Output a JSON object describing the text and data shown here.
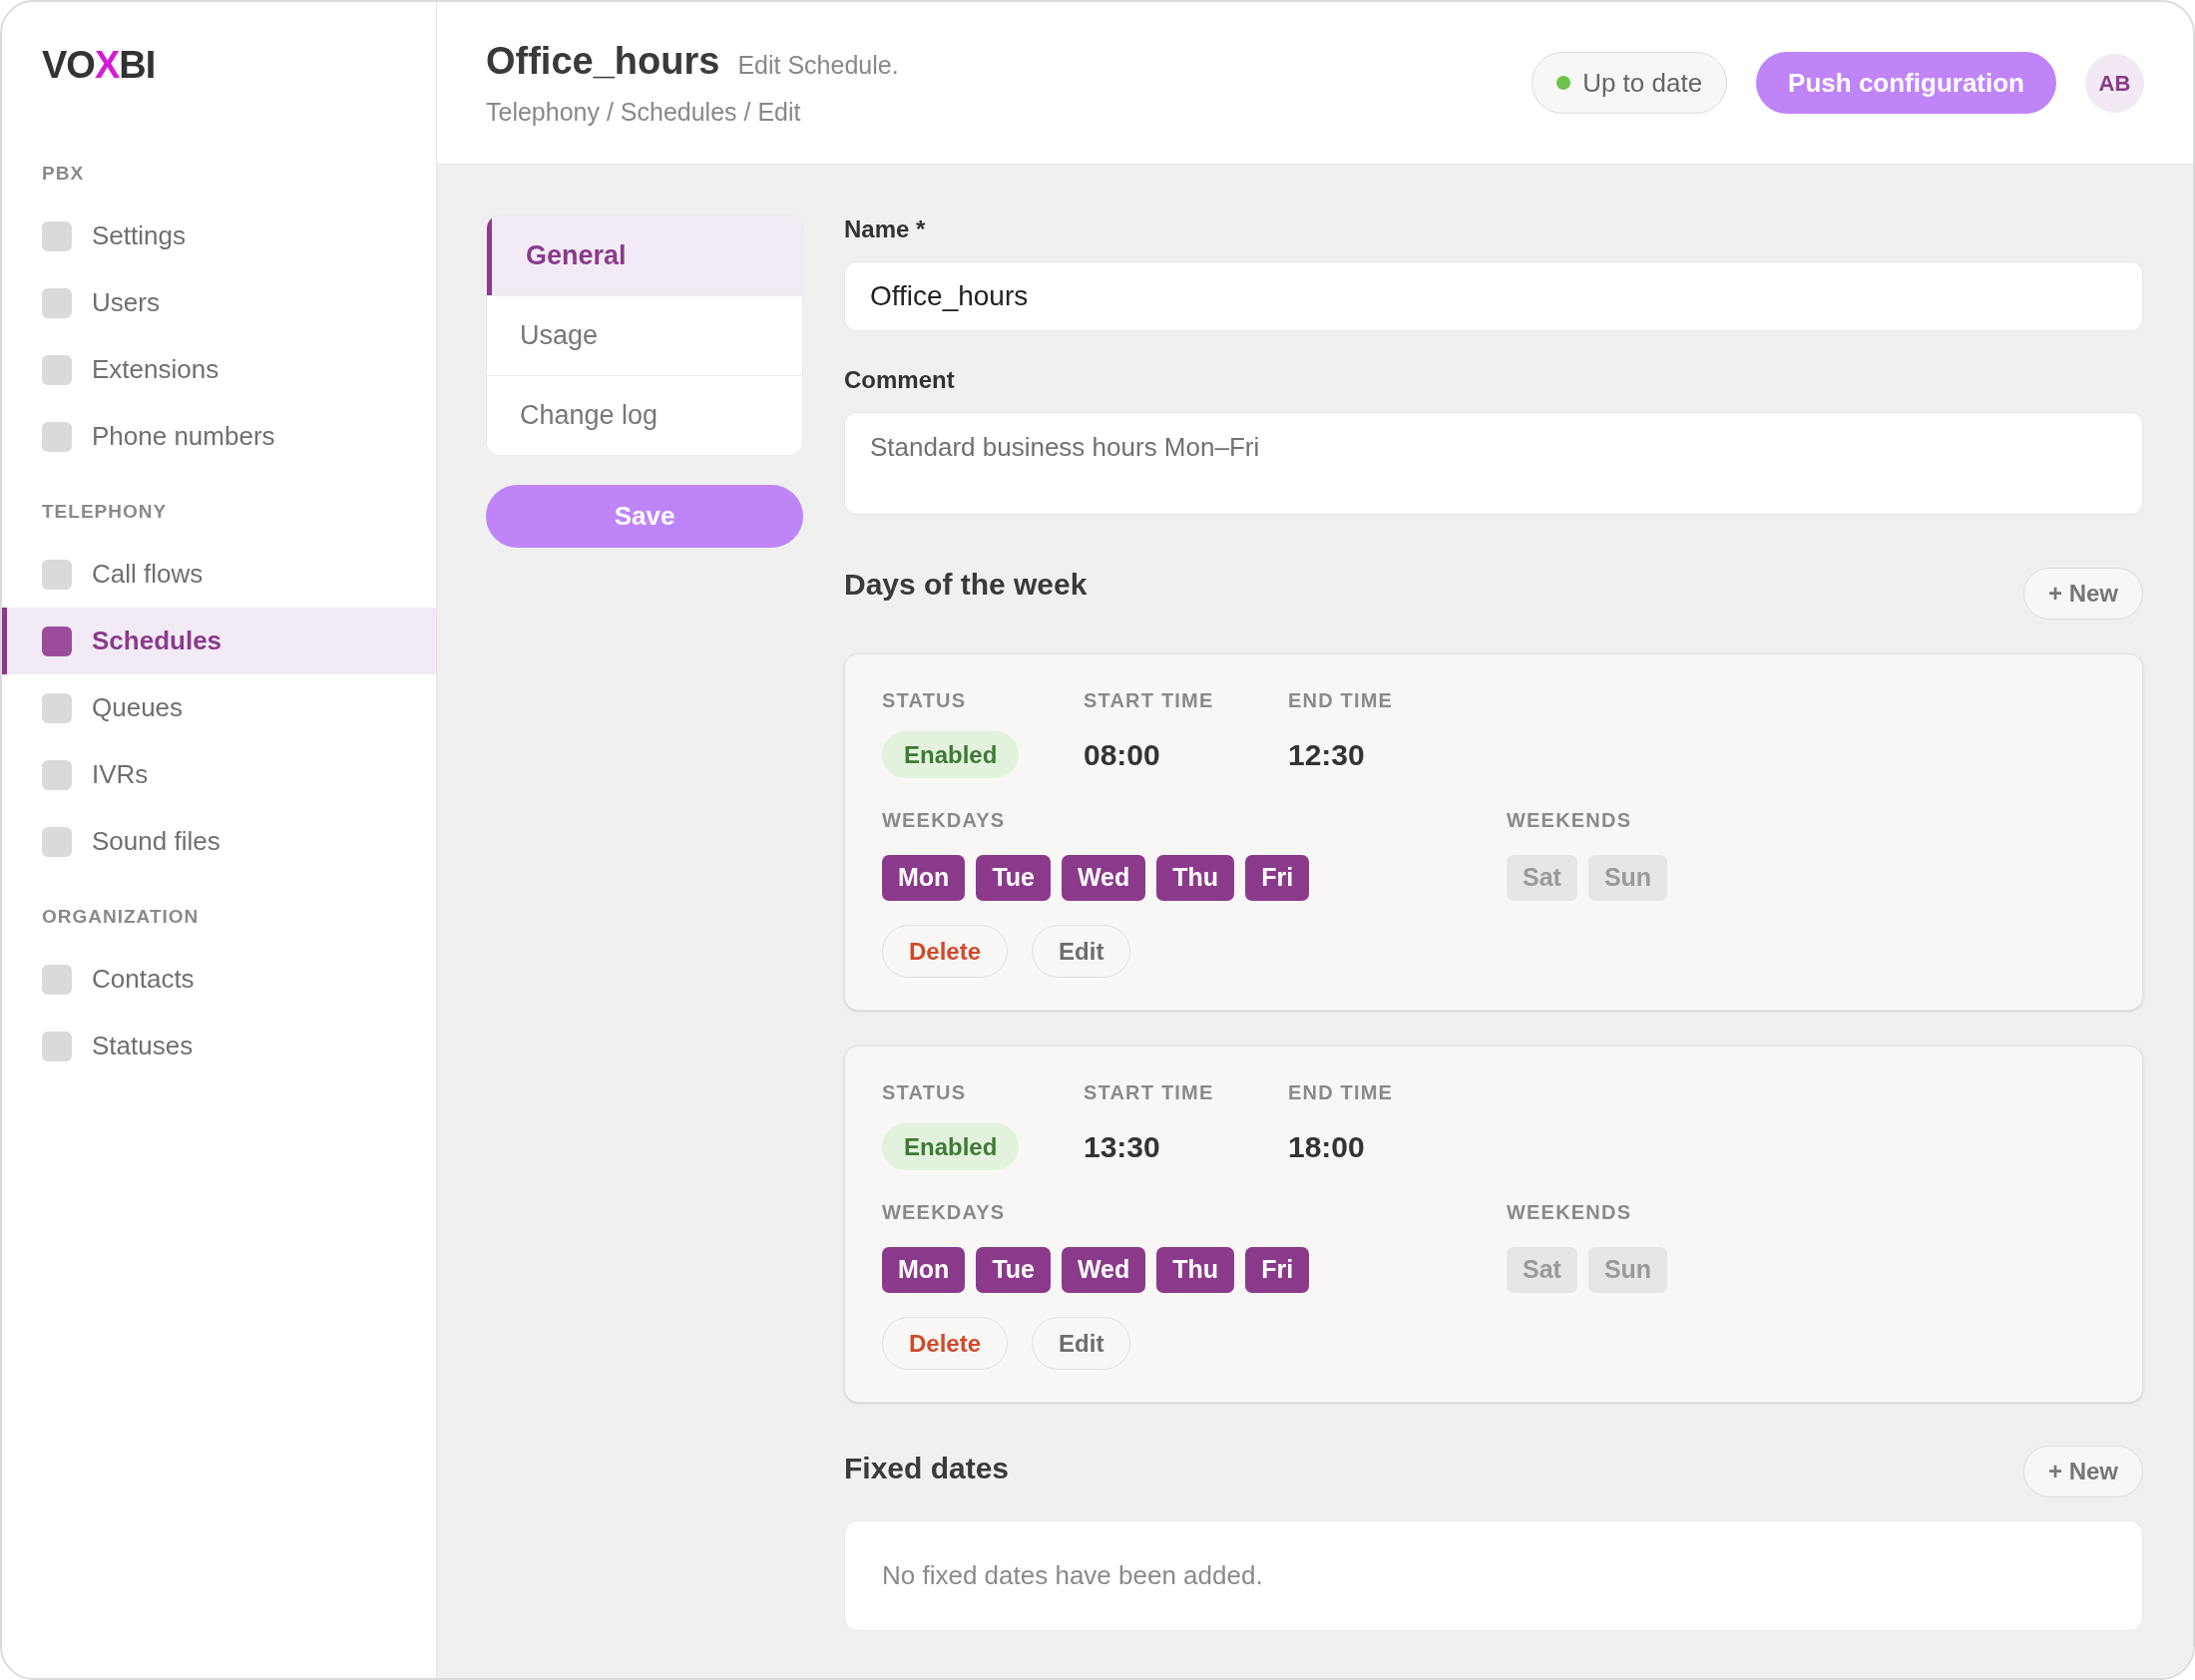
{
  "sidebar": {
    "logo": [
      {
        "text": "VO",
        "accent": false
      },
      {
        "text": "X",
        "accent": true
      },
      {
        "text": "BI",
        "accent": false
      }
    ],
    "sections": [
      {
        "heading": "PBX",
        "items": [
          {
            "label": "Settings",
            "selected": false
          },
          {
            "label": "Users",
            "selected": false
          },
          {
            "label": "Extensions",
            "selected": false
          },
          {
            "label": "Phone numbers",
            "selected": false
          }
        ]
      },
      {
        "heading": "TELEPHONY",
        "items": [
          {
            "label": "Call flows",
            "selected": false
          },
          {
            "label": "Schedules",
            "selected": true
          },
          {
            "label": "Queues",
            "selected": false
          },
          {
            "label": "IVRs",
            "selected": false
          },
          {
            "label": "Sound files",
            "selected": false
          }
        ]
      },
      {
        "heading": "ORGANIZATION",
        "items": [
          {
            "label": "Contacts",
            "selected": false
          },
          {
            "label": "Statuses",
            "selected": false
          }
        ]
      }
    ]
  },
  "header": {
    "title": "Office_hours",
    "subtitle": "Edit Schedule.",
    "breadcrumb": "Telephony / Schedules / Edit",
    "status": "Up to date",
    "push_button": "Push configuration",
    "avatar": "AB"
  },
  "tabs": [
    {
      "label": "General",
      "selected": true
    },
    {
      "label": "Usage",
      "selected": false
    },
    {
      "label": "Change log",
      "selected": false
    }
  ],
  "save_button": "Save",
  "form": {
    "name": {
      "label": "Name *",
      "value": "Office_hours"
    },
    "comment": {
      "label": "Comment",
      "value": "Standard business hours Mon–Fri"
    }
  },
  "days_of_week": {
    "title": "Days of the week",
    "new_button": "+ New",
    "entries": [
      {
        "status_label": "STATUS",
        "status": "Enabled",
        "start_label": "START TIME",
        "start": "08:00",
        "end_label": "END TIME",
        "end": "12:30",
        "weekdays_label": "WEEKDAYS",
        "weekdays": [
          {
            "label": "Mon",
            "selected": true
          },
          {
            "label": "Tue",
            "selected": true
          },
          {
            "label": "Wed",
            "selected": true
          },
          {
            "label": "Thu",
            "selected": true
          },
          {
            "label": "Fri",
            "selected": true
          }
        ],
        "weekends_label": "WEEKENDS",
        "weekends": [
          {
            "label": "Sat",
            "selected": false
          },
          {
            "label": "Sun",
            "selected": false
          }
        ],
        "actions": [
          {
            "label": "Delete",
            "kind": "danger"
          },
          {
            "label": "Edit",
            "kind": "plain"
          }
        ]
      },
      {
        "status_label": "STATUS",
        "status": "Enabled",
        "start_label": "START TIME",
        "start": "13:30",
        "end_label": "END TIME",
        "end": "18:00",
        "weekdays_label": "WEEKDAYS",
        "weekdays": [
          {
            "label": "Mon",
            "selected": true
          },
          {
            "label": "Tue",
            "selected": true
          },
          {
            "label": "Wed",
            "selected": true
          },
          {
            "label": "Thu",
            "selected": true
          },
          {
            "label": "Fri",
            "selected": true
          }
        ],
        "weekends_label": "WEEKENDS",
        "weekends": [
          {
            "label": "Sat",
            "selected": false
          },
          {
            "label": "Sun",
            "selected": false
          }
        ],
        "actions": [
          {
            "label": "Delete",
            "kind": "danger"
          },
          {
            "label": "Edit",
            "kind": "plain"
          }
        ]
      }
    ]
  },
  "fixed_dates": {
    "title": "Fixed dates",
    "new_button": "+ New",
    "empty_text": "No fixed dates have been added."
  }
}
